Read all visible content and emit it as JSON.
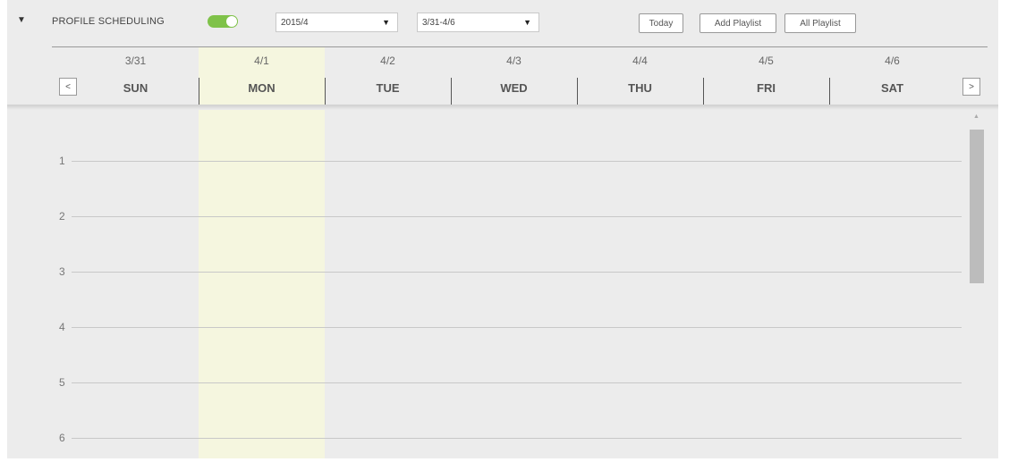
{
  "header": {
    "collapse_icon": "▼",
    "title": "PROFILE SCHEDULING",
    "toggle_on": true,
    "month_select": {
      "value": "2015/4"
    },
    "week_select": {
      "value": "3/31-4/6"
    },
    "today_button": "Today",
    "add_playlist_button": "Add Playlist",
    "all_playlist_button": "All Playlist",
    "colors": {
      "toggle": "#7fc249",
      "today_highlight": "#f5f6df"
    }
  },
  "nav": {
    "prev": "<",
    "next": ">"
  },
  "days": [
    {
      "date": "3/31",
      "day": "SUN"
    },
    {
      "date": "4/1",
      "day": "MON",
      "today": true
    },
    {
      "date": "4/2",
      "day": "TUE"
    },
    {
      "date": "4/3",
      "day": "WED"
    },
    {
      "date": "4/4",
      "day": "THU"
    },
    {
      "date": "4/5",
      "day": "FRI"
    },
    {
      "date": "4/6",
      "day": "SAT"
    }
  ],
  "hours": [
    "1",
    "2",
    "3",
    "4",
    "5",
    "6"
  ]
}
